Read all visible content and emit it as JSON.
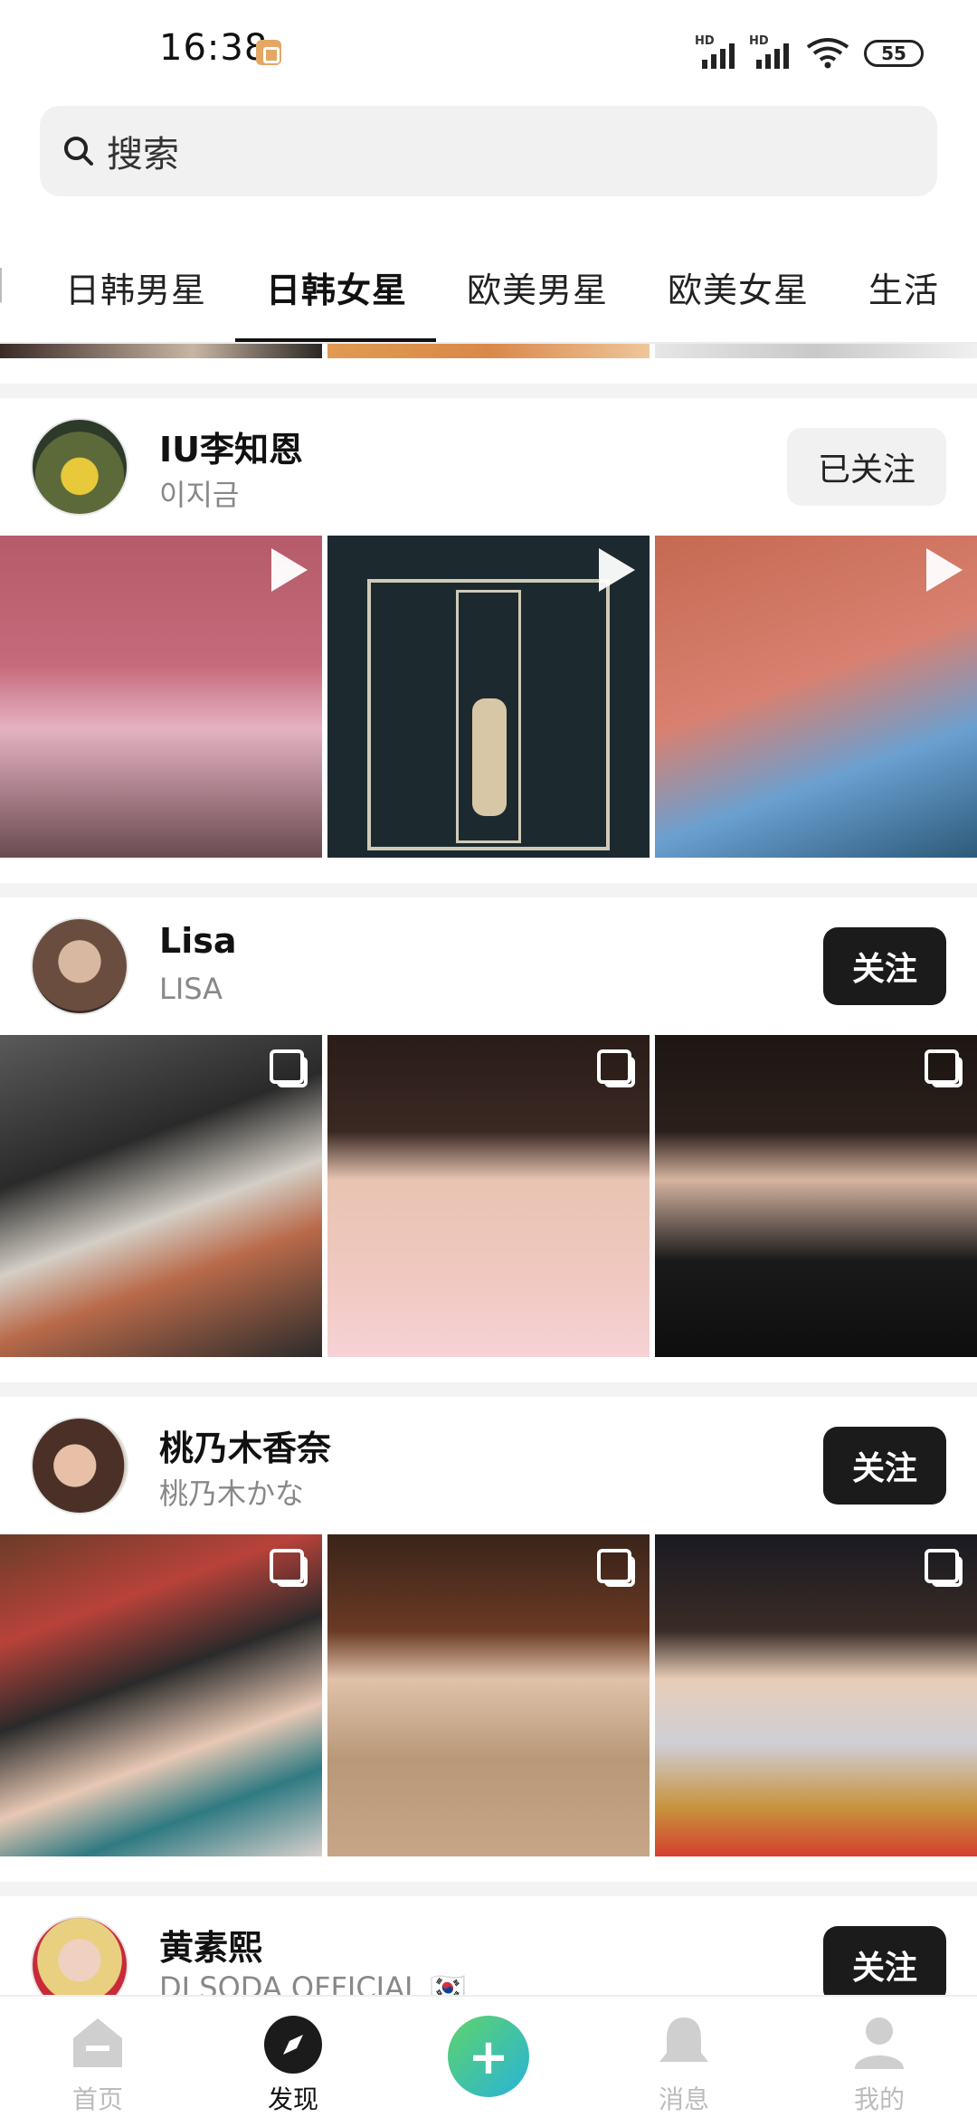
{
  "status_bar": {
    "time": "16:38",
    "battery": "55",
    "network": "HD"
  },
  "search": {
    "label": "搜索"
  },
  "tabs": [
    "日韩男星",
    "日韩女星",
    "欧美男星",
    "欧美女星",
    "生活"
  ],
  "active_tab": "日韩女星",
  "users": [
    {
      "name": "IU李知恩",
      "handle": "이지금",
      "button": "已关注",
      "media": "video"
    },
    {
      "name": "Lisa",
      "handle": "LISA",
      "button": "关注",
      "media": "album"
    },
    {
      "name": "桃乃木香奈",
      "handle": "桃乃木かな",
      "button": "关注",
      "media": "album"
    },
    {
      "name": "黄素熙",
      "handle": "DJ SODA OFFICIAL 🇰🇷",
      "button": "关注"
    }
  ],
  "bottom_nav": [
    {
      "label": "首页",
      "icon": "home-icon"
    },
    {
      "label": "发现",
      "icon": "compass-icon"
    },
    {
      "label": "",
      "icon": "plus-icon"
    },
    {
      "label": "消息",
      "icon": "bell-icon"
    },
    {
      "label": "我的",
      "icon": "profile-icon"
    }
  ],
  "colors": {
    "accent": "#1b1b1b",
    "plus_gradient_start": "#5fd36a",
    "plus_gradient_end": "#28b3d9"
  }
}
